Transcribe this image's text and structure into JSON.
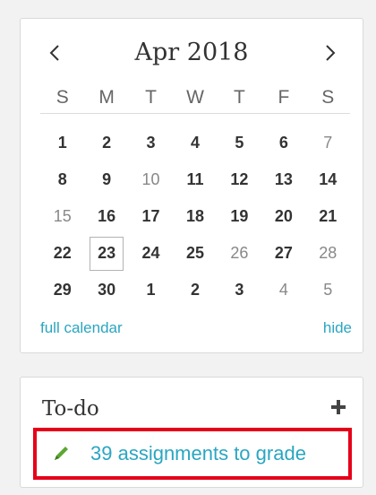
{
  "calendar": {
    "month_label": "Apr 2018",
    "prev_icon": "chevron-left-icon",
    "next_icon": "chevron-right-icon",
    "weekdays": [
      "S",
      "M",
      "T",
      "W",
      "T",
      "F",
      "S"
    ],
    "weeks": [
      [
        {
          "d": "1",
          "muted": false
        },
        {
          "d": "2",
          "muted": false
        },
        {
          "d": "3",
          "muted": false
        },
        {
          "d": "4",
          "muted": false
        },
        {
          "d": "5",
          "muted": false
        },
        {
          "d": "6",
          "muted": false
        },
        {
          "d": "7",
          "muted": true
        }
      ],
      [
        {
          "d": "8",
          "muted": false
        },
        {
          "d": "9",
          "muted": false
        },
        {
          "d": "10",
          "muted": true
        },
        {
          "d": "11",
          "muted": false
        },
        {
          "d": "12",
          "muted": false
        },
        {
          "d": "13",
          "muted": false
        },
        {
          "d": "14",
          "muted": false
        }
      ],
      [
        {
          "d": "15",
          "muted": true
        },
        {
          "d": "16",
          "muted": false
        },
        {
          "d": "17",
          "muted": false
        },
        {
          "d": "18",
          "muted": false
        },
        {
          "d": "19",
          "muted": false
        },
        {
          "d": "20",
          "muted": false
        },
        {
          "d": "21",
          "muted": false
        }
      ],
      [
        {
          "d": "22",
          "muted": false
        },
        {
          "d": "23",
          "muted": false,
          "today": true
        },
        {
          "d": "24",
          "muted": false
        },
        {
          "d": "25",
          "muted": false
        },
        {
          "d": "26",
          "muted": true
        },
        {
          "d": "27",
          "muted": false
        },
        {
          "d": "28",
          "muted": true
        }
      ],
      [
        {
          "d": "29",
          "muted": false
        },
        {
          "d": "30",
          "muted": false
        },
        {
          "d": "1",
          "muted": false
        },
        {
          "d": "2",
          "muted": false
        },
        {
          "d": "3",
          "muted": false
        },
        {
          "d": "4",
          "muted": true
        },
        {
          "d": "5",
          "muted": true
        }
      ]
    ],
    "full_calendar_label": "full calendar",
    "hide_label": "hide"
  },
  "todo": {
    "title": "To-do",
    "add_icon": "plus-icon",
    "item_icon": "pencil-icon",
    "item_label": "39 assignments to grade"
  },
  "colors": {
    "link": "#2aa6c1",
    "highlight_border": "#e5001a",
    "pencil": "#5aa832"
  }
}
